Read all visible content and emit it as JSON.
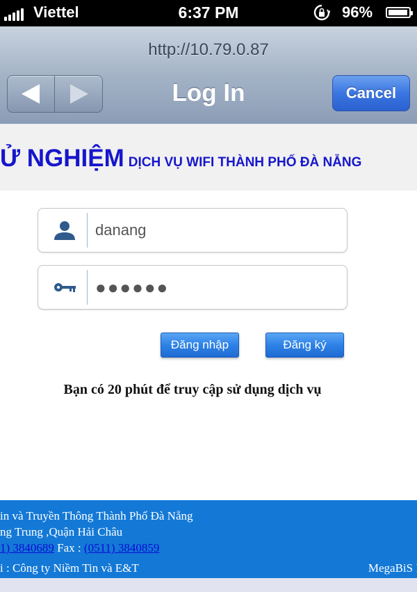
{
  "status_bar": {
    "carrier": "Viettel",
    "time": "6:37 PM",
    "battery_percent": "96%",
    "battery_level": 0.96
  },
  "navbar": {
    "url": "http://10.79.0.87",
    "title": "Log In",
    "cancel_label": "Cancel"
  },
  "header": {
    "title_big": "Ử NGHIỆM",
    "title_small": "DỊCH VỤ WIFI THÀNH PHỐ ĐÀ NẴNG",
    "color": "#1616cc"
  },
  "form": {
    "username_value": "danang",
    "password_value": "●●●●●●",
    "login_label": "Đăng nhập",
    "register_label": "Đăng ký"
  },
  "notice": "Bạn có 20 phút để truy cập sử dụng dịch vụ",
  "footer": {
    "line1": "in và Truyền Thông Thành Phố Đà Nẵng",
    "line2": "ng Trung ,Quận Hải Châu",
    "phone": "1) 3840689",
    "fax_label": " Fax : ",
    "fax": "(0511) 3840859",
    "line4": "i : Công ty Niềm Tin và E&T",
    "brand": "MegaBiS I",
    "background": "#1479d6"
  }
}
